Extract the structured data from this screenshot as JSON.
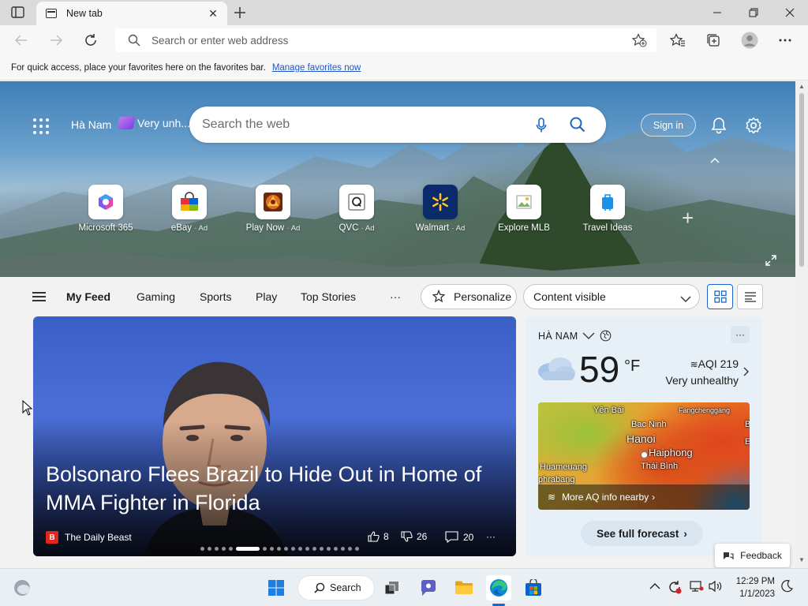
{
  "browser": {
    "tab_title": "New tab",
    "address_placeholder": "Search or enter web address",
    "favorites_bar_text": "For quick access, place your favorites here on the favorites bar.",
    "favorites_bar_link": "Manage favorites now"
  },
  "hero": {
    "location": "Hà Nam",
    "aqi_short": "Very unh...",
    "search_placeholder": "Search the web",
    "sign_in": "Sign in",
    "tiles": [
      {
        "label": "Microsoft 365",
        "ad": ""
      },
      {
        "label": "eBay",
        "ad": "· Ad"
      },
      {
        "label": "Play Now",
        "ad": "· Ad"
      },
      {
        "label": "QVC",
        "ad": "· Ad"
      },
      {
        "label": "Walmart",
        "ad": "· Ad"
      },
      {
        "label": "Explore MLB",
        "ad": ""
      },
      {
        "label": "Travel Ideas",
        "ad": ""
      }
    ]
  },
  "feed": {
    "tabs": [
      "My Feed",
      "Gaming",
      "Sports",
      "Play",
      "Top Stories"
    ],
    "more": "···",
    "personalize": "Personalize",
    "content_visibility": "Content visible"
  },
  "story": {
    "headline": "Bolsonaro Flees Brazil to Hide Out in Home of MMA Fighter in Florida",
    "source": "The Daily Beast",
    "likes": "8",
    "dislikes": "26",
    "comments": "20",
    "carousel_count": 20,
    "carousel_current": 5
  },
  "weather": {
    "location": "HÀ NAM",
    "temperature": "59",
    "unit": "°F",
    "aqi_label": "AQI 219",
    "aqi_status": "Very unhealthy",
    "map_labels": [
      "Yên Bái",
      "Fangchenggang",
      "Bac Ninh",
      "Hanoi",
      "Haiphong",
      "Huameuang",
      "Thái Bình",
      "phrabang",
      "B",
      "E"
    ],
    "map_link": "More AQ info nearby",
    "forecast_button": "See full forecast"
  },
  "feedback": "Feedback",
  "taskbar": {
    "search_label": "Search",
    "time": "12:29 PM",
    "date": "1/1/2023"
  },
  "colors": {
    "accent": "#1a66c9",
    "link": "#1a57c9",
    "aqi_purple": "#7b3fe0"
  }
}
